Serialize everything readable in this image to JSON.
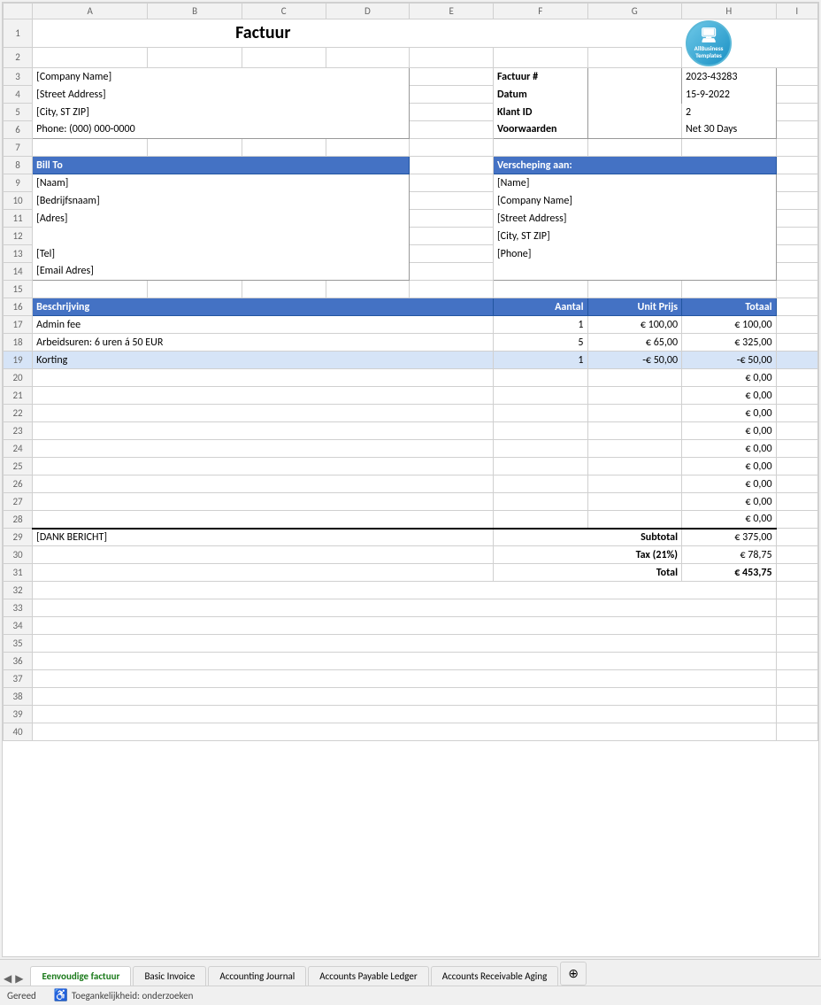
{
  "title": "Factuur",
  "logo": {
    "icon": "🖥",
    "line1": "AllBusiness",
    "line2": "Templates"
  },
  "company": {
    "name": "[Company Name]",
    "street": "[Street Address]",
    "city": "[City, ST ZIP]",
    "phone": "Phone: (000) 000-0000"
  },
  "invoice_info": {
    "labels": [
      "Factuur #",
      "Datum",
      "Klant ID",
      "Voorwaarden"
    ],
    "values": [
      "2023-43283",
      "15-9-2022",
      "2",
      "Net 30 Days"
    ]
  },
  "bill_to": {
    "header": "Bill To",
    "fields": [
      "[Naam]",
      "[Bedrijfsnaam]",
      "[Adres]",
      "",
      "[Tel]",
      "[Email Adres]"
    ]
  },
  "ship_to": {
    "header": "Verscheping aan:",
    "fields": [
      "[Name]",
      "[Company Name]",
      "[Street Address]",
      "[City, ST ZIP]",
      "[Phone]"
    ]
  },
  "table": {
    "headers": [
      "Beschrijving",
      "Aantal",
      "Unit Prijs",
      "Totaal"
    ],
    "rows": [
      {
        "desc": "Admin fee",
        "qty": "1",
        "unit": "€ 100,00",
        "total": "€ 100,00"
      },
      {
        "desc": "Arbeidsuren: 6 uren  á 50 EUR",
        "qty": "5",
        "unit": "€ 65,00",
        "total": "€ 325,00"
      },
      {
        "desc": "Korting",
        "qty": "1",
        "unit": "-€ 50,00",
        "total": "-€ 50,00"
      },
      {
        "desc": "",
        "qty": "",
        "unit": "",
        "total": "€ 0,00"
      },
      {
        "desc": "",
        "qty": "",
        "unit": "",
        "total": "€ 0,00"
      },
      {
        "desc": "",
        "qty": "",
        "unit": "",
        "total": "€ 0,00"
      },
      {
        "desc": "",
        "qty": "",
        "unit": "",
        "total": "€ 0,00"
      },
      {
        "desc": "",
        "qty": "",
        "unit": "",
        "total": "€ 0,00"
      },
      {
        "desc": "",
        "qty": "",
        "unit": "",
        "total": "€ 0,00"
      },
      {
        "desc": "",
        "qty": "",
        "unit": "",
        "total": "€ 0,00"
      },
      {
        "desc": "",
        "qty": "",
        "unit": "",
        "total": "€ 0,00"
      },
      {
        "desc": "",
        "qty": "",
        "unit": "",
        "total": "€ 0,00"
      }
    ],
    "thank_you": "[DANK BERICHT]",
    "subtotal_label": "Subtotal",
    "subtotal_value": "€ 375,00",
    "tax_label": "Tax (21%)",
    "tax_value": "€ 78,75",
    "total_label": "Total",
    "total_value": "€ 453,75"
  },
  "cols": [
    "A",
    "B",
    "C",
    "D",
    "E",
    "F",
    "G",
    "H",
    "I"
  ],
  "empty_rows": [
    32,
    33,
    34,
    35,
    36,
    37,
    38,
    39,
    40
  ],
  "tabs": [
    {
      "label": "Eenvoudige factuur",
      "active": true
    },
    {
      "label": "Basic Invoice",
      "active": false
    },
    {
      "label": "Accounting Journal",
      "active": false
    },
    {
      "label": "Accounts Payable Ledger",
      "active": false
    },
    {
      "label": "Accounts Receivable Aging",
      "active": false
    }
  ],
  "status": {
    "ready": "Gereed",
    "accessibility": "Toegankelijkheid: onderzoeken"
  }
}
